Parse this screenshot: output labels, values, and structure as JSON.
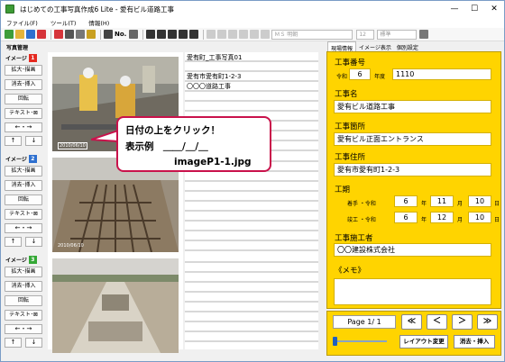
{
  "window": {
    "title": "はじめての工事写真作成6 Lite - 愛有ビル道路工事",
    "min": "—",
    "max": "☐",
    "close": "✕"
  },
  "menu": [
    "ファイル(F)",
    "ツール(T)",
    "情報(H)"
  ],
  "toolbar": {
    "text_no": "No.",
    "font": "ＭＳ 明朝",
    "size": "12",
    "style": "標準"
  },
  "left": {
    "header": "写真管理",
    "images": [
      {
        "label": "イメージ",
        "num": "1"
      },
      {
        "label": "イメージ",
        "num": "2"
      },
      {
        "label": "イメージ",
        "num": "3"
      }
    ],
    "btn_zoom": "拡大･描画",
    "btn_delete": "消去･挿入",
    "btn_rotate": "回転",
    "btn_text": "テキスト･⊠",
    "arrow_lr": "←・→",
    "arrow_up": "↑",
    "arrow_down": "↓"
  },
  "photo_dates": [
    "2010/06/10",
    "2010/06/10"
  ],
  "description": {
    "line1": "愛有町_工事写真01",
    "line2": "愛有市愛有町1-2-3",
    "line3": "〇〇〇道路工事"
  },
  "callout": {
    "line1": "日付の上をクリック！",
    "line2": "表示例　＿＿/＿/＿",
    "line3": "imageP1-1.jpg"
  },
  "tabs": [
    "現場情報",
    "イメージ表示",
    "個別設定"
  ],
  "panel": {
    "no_label": "工事番号",
    "era": "令和",
    "year": "6",
    "year_unit": "年度",
    "no_value": "1110",
    "name_label": "工事名",
    "name_value": "愛有ビル道路工事",
    "place_label": "工事箇所",
    "place_value": "愛有ビル正面エントランス",
    "addr_label": "工事住所",
    "addr_value": "愛有市愛有町1-2-3",
    "period_label": "工期",
    "start_label": "着手 ・令和",
    "start_y": "6",
    "start_m": "11",
    "start_d": "10",
    "end_label": "竣工 ・令和",
    "end_y": "6",
    "end_m": "12",
    "end_d": "10",
    "year_ch": "年",
    "month_ch": "月",
    "day_ch": "日",
    "contractor_label": "工事施工者",
    "contractor_value": "〇〇建設株式会社",
    "memo_label": "《メモ》"
  },
  "pager": {
    "page": "Page  1/ 1",
    "first": "≪",
    "prev": "＜",
    "next": "＞",
    "last": "≫",
    "layout_btn": "レイアウト変更",
    "delete_btn": "消去・挿入"
  },
  "colors": {
    "accent_yellow": "#ffd400",
    "callout_border": "#c9124b",
    "num_red": "#e52920",
    "num_blue": "#2d6fcf",
    "num_green": "#34a835"
  }
}
